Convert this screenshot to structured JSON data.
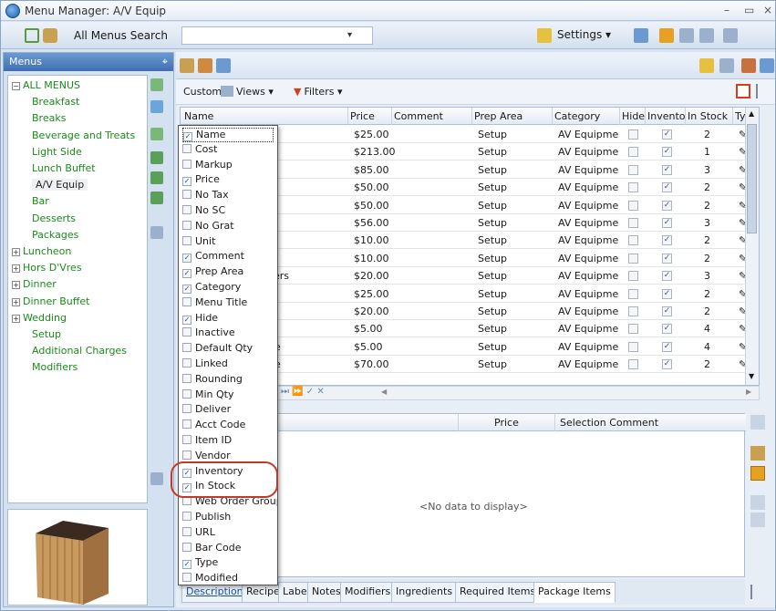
{
  "window": {
    "title": "Menu Manager: A/V Equip",
    "minimize": "–",
    "restore": "▭",
    "close": "×"
  },
  "toolbar": {
    "search_label": "All Menus Search",
    "search_value": "",
    "settings_label": "Settings ▾"
  },
  "menus_panel": {
    "title": "Menus",
    "pin": "⌖",
    "tree": [
      {
        "label": "ALL MENUS",
        "level": 0,
        "expander": "−"
      },
      {
        "label": "Breakfast",
        "level": 1
      },
      {
        "label": "Breaks",
        "level": 1
      },
      {
        "label": "Beverage and Treats",
        "level": 1
      },
      {
        "label": "Light Side",
        "level": 1
      },
      {
        "label": "Lunch Buffet",
        "level": 1
      },
      {
        "label": "A/V Equip",
        "level": 1,
        "selected": true
      },
      {
        "label": "Bar",
        "level": 1
      },
      {
        "label": "Desserts",
        "level": 1
      },
      {
        "label": "Packages",
        "level": 1
      },
      {
        "label": "Luncheon",
        "level": 0,
        "expander": "+"
      },
      {
        "label": "Hors D'Vres",
        "level": 0,
        "expander": "+"
      },
      {
        "label": "Dinner",
        "level": 0,
        "expander": "+"
      },
      {
        "label": "Dinner Buffet",
        "level": 0,
        "expander": "+"
      },
      {
        "label": "Wedding",
        "level": 0,
        "expander": "+"
      },
      {
        "label": "Setup",
        "level": 1
      },
      {
        "label": "Additional Charges",
        "level": 1
      },
      {
        "label": "Modifiers",
        "level": 1
      }
    ]
  },
  "custom_bar": {
    "custom_label": "Custom:",
    "views_label": "Views ▾",
    "filters_label": "Filters ▾"
  },
  "grid": {
    "columns": [
      "Name",
      "Price",
      "Comment",
      "Prep Area",
      "Category",
      "Hide",
      "Invento",
      "In Stock",
      "Type"
    ],
    "rows": [
      {
        "name": "n",
        "price": "$25.00",
        "prep": "Setup",
        "category": "AV Equipme",
        "hide": "",
        "inv": "✓",
        "stock": "2",
        "type": "✎"
      },
      {
        "name": "",
        "price": "$213.00",
        "prep": "Setup",
        "category": "AV Equipme",
        "hide": "",
        "inv": "✓",
        "stock": "1",
        "type": "✎"
      },
      {
        "name": "",
        "price": "$85.00",
        "prep": "Setup",
        "category": "AV Equipme",
        "hide": "",
        "inv": "✓",
        "stock": "3",
        "type": "✎"
      },
      {
        "name": "",
        "price": "$50.00",
        "prep": "Setup",
        "category": "AV Equipme",
        "hide": "",
        "inv": "✓",
        "stock": "2",
        "type": "✎"
      },
      {
        "name": "",
        "price": "$50.00",
        "prep": "Setup",
        "category": "AV Equipme",
        "hide": "",
        "inv": "✓",
        "stock": "2",
        "type": "✎"
      },
      {
        "name": "",
        "price": "$56.00",
        "prep": "Setup",
        "category": "AV Equipme",
        "hide": "",
        "inv": "✓",
        "stock": "3",
        "type": "✎"
      },
      {
        "name": "",
        "price": "$10.00",
        "prep": "Setup",
        "category": "AV Equipme",
        "hide": "",
        "inv": "✓",
        "stock": "2",
        "type": "✎"
      },
      {
        "name": "",
        "price": "$10.00",
        "prep": "Setup",
        "category": "AV Equipme",
        "hide": "",
        "inv": "✓",
        "stock": "2",
        "type": "✎"
      },
      {
        "name": "kers",
        "price": "$20.00",
        "prep": "Setup",
        "category": "AV Equipme",
        "hide": "",
        "inv": "✓",
        "stock": "3",
        "type": "✎"
      },
      {
        "name": "",
        "price": "$25.00",
        "prep": "Setup",
        "category": "AV Equipme",
        "hide": "",
        "inv": "✓",
        "stock": "2",
        "type": "✎"
      },
      {
        "name": "",
        "price": "$20.00",
        "prep": "Setup",
        "category": "AV Equipme",
        "hide": "",
        "inv": "✓",
        "stock": "2",
        "type": "✎"
      },
      {
        "name": "",
        "price": "$5.00",
        "prep": "Setup",
        "category": "AV Equipme",
        "hide": "",
        "inv": "✓",
        "stock": "4",
        "type": "✎"
      },
      {
        "name": "ne",
        "price": "$5.00",
        "prep": "Setup",
        "category": "AV Equipme",
        "hide": "",
        "inv": "✓",
        "stock": "4",
        "type": "✎"
      },
      {
        "name": "he",
        "price": "$70.00",
        "prep": "Setup",
        "category": "AV Equipme",
        "hide": "",
        "inv": "✓",
        "stock": "2",
        "type": "✎"
      }
    ],
    "nav": "⏭ ⏩ ✓ ✕"
  },
  "detail": {
    "columns": [
      "Price",
      "Selection Comment"
    ],
    "empty": "<No data to display>"
  },
  "tabs": [
    "Description",
    "Recipe",
    "Label",
    "Notes",
    "Modifiers",
    "Ingredients",
    "Required Items",
    "Package Items"
  ],
  "column_chooser": [
    {
      "label": "Name",
      "checked": true
    },
    {
      "label": "Cost",
      "checked": false
    },
    {
      "label": "Markup",
      "checked": false
    },
    {
      "label": "Price",
      "checked": true
    },
    {
      "label": "No Tax",
      "checked": false
    },
    {
      "label": "No SC",
      "checked": false
    },
    {
      "label": "No Grat",
      "checked": false
    },
    {
      "label": "Unit",
      "checked": false
    },
    {
      "label": "Comment",
      "checked": true
    },
    {
      "label": "Prep Area",
      "checked": true
    },
    {
      "label": "Category",
      "checked": true
    },
    {
      "label": "Menu Title",
      "checked": false
    },
    {
      "label": "Hide",
      "checked": true
    },
    {
      "label": "Inactive",
      "checked": false
    },
    {
      "label": "Default Qty",
      "checked": false
    },
    {
      "label": "Linked",
      "checked": false
    },
    {
      "label": "Rounding",
      "checked": false
    },
    {
      "label": "Min Qty",
      "checked": false
    },
    {
      "label": "Deliver",
      "checked": false
    },
    {
      "label": "Acct Code",
      "checked": false
    },
    {
      "label": "Item ID",
      "checked": false
    },
    {
      "label": "Vendor",
      "checked": false
    },
    {
      "label": "Inventory",
      "checked": true
    },
    {
      "label": "In Stock",
      "checked": true
    },
    {
      "label": "Web Order Group",
      "checked": false
    },
    {
      "label": "Publish",
      "checked": false
    },
    {
      "label": "URL",
      "checked": false
    },
    {
      "label": "Bar Code",
      "checked": false
    },
    {
      "label": "Type",
      "checked": true
    },
    {
      "label": "Modified",
      "checked": false
    }
  ],
  "colors": {
    "accent": "#3f6fb0",
    "tree_text": "#1a8a1a",
    "highlight": "#c0392b"
  }
}
